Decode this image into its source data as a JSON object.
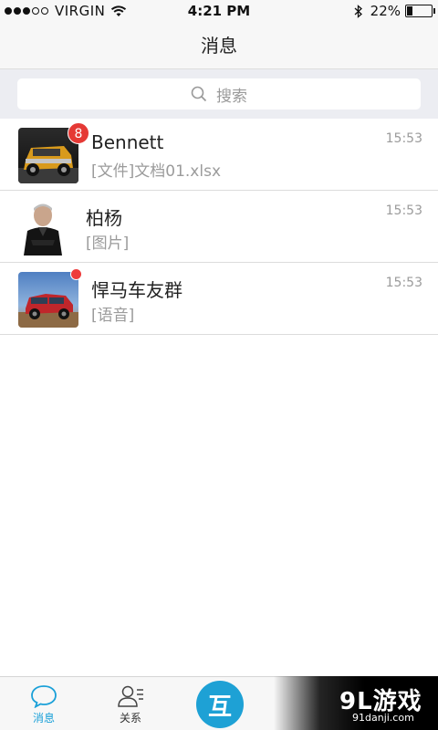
{
  "status_bar": {
    "carrier": "VIRGIN",
    "time": "4:21 PM",
    "battery": "22%",
    "battery_level": 0.22,
    "signal_bars": 3,
    "signal_total": 5
  },
  "nav": {
    "title": "消息"
  },
  "search": {
    "placeholder": "搜索"
  },
  "conversations": [
    {
      "name": "Bennett",
      "preview": "[文件]文档01.xlsx",
      "time": "15:53",
      "badge": "8",
      "avatar": "yellow-hummer-avatar"
    },
    {
      "name": "柏杨",
      "preview": "[图片]",
      "time": "15:53",
      "badge": "",
      "avatar": "man-in-black-avatar"
    },
    {
      "name": "悍马车友群",
      "preview": "[语音]",
      "time": "15:53",
      "badge": "dot",
      "avatar": "red-hummer-avatar"
    }
  ],
  "tabs": [
    {
      "label": "消息",
      "icon": "chat-bubble-icon",
      "active": true
    },
    {
      "label": "关系",
      "icon": "contacts-icon",
      "active": false
    }
  ],
  "center_button": {
    "glyph": "互"
  },
  "watermark": {
    "logo": "9L游戏",
    "url": "91danji.com"
  },
  "colors": {
    "accent": "#1aa0d8",
    "badge": "#e53935",
    "time_text": "#9b9b9b"
  }
}
